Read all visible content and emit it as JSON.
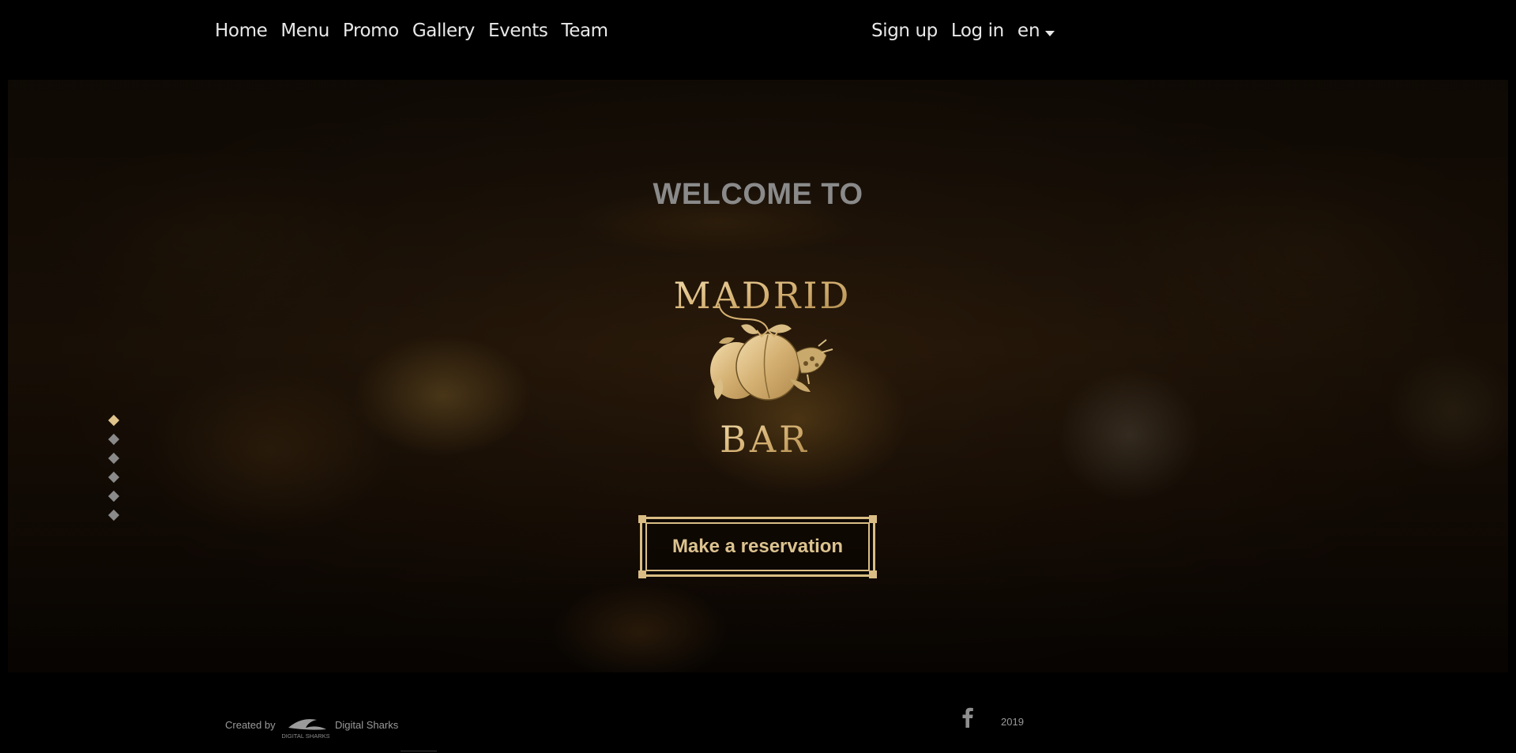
{
  "nav": {
    "links": [
      "Home",
      "Menu",
      "Promo",
      "Gallery",
      "Events",
      "Team"
    ],
    "signup": "Sign up",
    "login": "Log in",
    "language": "en"
  },
  "hero": {
    "welcome": "WELCOME TO",
    "logo_top": "MADRID",
    "logo_bottom": "BAR",
    "cta": "Make a reservation",
    "slides_total": 6,
    "active_slide": 1
  },
  "footer": {
    "created_by": "Created by",
    "company_logo_text": "DIGITAL SHARKS",
    "company": "Digital Sharks",
    "year": "2019",
    "social_icon": "facebook-icon"
  },
  "colors": {
    "gold": "#d9bd84",
    "nav_text": "#e8e8e8",
    "welcome_text": "#8a8a8a"
  }
}
